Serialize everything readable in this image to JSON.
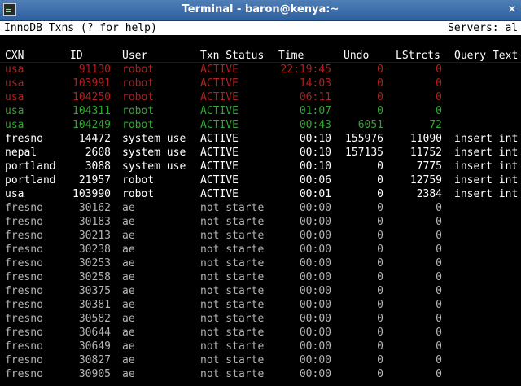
{
  "window": {
    "title": "Terminal - baron@kenya:~",
    "close_glyph": "×"
  },
  "infobar": {
    "left": "InnoDB Txns (? for help)",
    "right": "Servers: al"
  },
  "table": {
    "columns": [
      "CXN",
      "ID",
      "User",
      "Txn Status",
      "Time",
      "Undo",
      "LStrcts",
      "Query Text"
    ],
    "rows": [
      {
        "cxn": "usa",
        "id": "91130",
        "user": "robot",
        "status": "ACTIVE",
        "time": "22:19:45",
        "undo": "0",
        "lstr": "0",
        "query": "",
        "color": "red"
      },
      {
        "cxn": "usa",
        "id": "103991",
        "user": "robot",
        "status": "ACTIVE",
        "time": "14:03",
        "undo": "0",
        "lstr": "0",
        "query": "",
        "color": "red"
      },
      {
        "cxn": "usa",
        "id": "104250",
        "user": "robot",
        "status": "ACTIVE",
        "time": "06:11",
        "undo": "0",
        "lstr": "0",
        "query": "",
        "color": "red"
      },
      {
        "cxn": "usa",
        "id": "104311",
        "user": "robot",
        "status": "ACTIVE",
        "time": "01:07",
        "undo": "0",
        "lstr": "0",
        "query": "",
        "color": "green"
      },
      {
        "cxn": "usa",
        "id": "104249",
        "user": "robot",
        "status": "ACTIVE",
        "time": "00:43",
        "undo": "6051",
        "lstr": "72",
        "query": "",
        "color": "green"
      },
      {
        "cxn": "fresno",
        "id": "14472",
        "user": "system use",
        "status": "ACTIVE",
        "time": "00:10",
        "undo": "155976",
        "lstr": "11090",
        "query": "insert int",
        "color": "white"
      },
      {
        "cxn": "nepal",
        "id": "2608",
        "user": "system use",
        "status": "ACTIVE",
        "time": "00:10",
        "undo": "157135",
        "lstr": "11752",
        "query": "insert int",
        "color": "white"
      },
      {
        "cxn": "portland",
        "id": "3088",
        "user": "system use",
        "status": "ACTIVE",
        "time": "00:10",
        "undo": "0",
        "lstr": "7775",
        "query": "insert int",
        "color": "white"
      },
      {
        "cxn": "portland",
        "id": "21957",
        "user": "robot",
        "status": "ACTIVE",
        "time": "00:06",
        "undo": "0",
        "lstr": "12759",
        "query": "insert int",
        "color": "white"
      },
      {
        "cxn": "usa",
        "id": "103990",
        "user": "robot",
        "status": "ACTIVE",
        "time": "00:01",
        "undo": "0",
        "lstr": "2384",
        "query": "insert int",
        "color": "white"
      },
      {
        "cxn": "fresno",
        "id": "30162",
        "user": "ae",
        "status": "not starte",
        "time": "00:00",
        "undo": "0",
        "lstr": "0",
        "query": "",
        "color": "gray"
      },
      {
        "cxn": "fresno",
        "id": "30183",
        "user": "ae",
        "status": "not starte",
        "time": "00:00",
        "undo": "0",
        "lstr": "0",
        "query": "",
        "color": "gray"
      },
      {
        "cxn": "fresno",
        "id": "30213",
        "user": "ae",
        "status": "not starte",
        "time": "00:00",
        "undo": "0",
        "lstr": "0",
        "query": "",
        "color": "gray"
      },
      {
        "cxn": "fresno",
        "id": "30238",
        "user": "ae",
        "status": "not starte",
        "time": "00:00",
        "undo": "0",
        "lstr": "0",
        "query": "",
        "color": "gray"
      },
      {
        "cxn": "fresno",
        "id": "30253",
        "user": "ae",
        "status": "not starte",
        "time": "00:00",
        "undo": "0",
        "lstr": "0",
        "query": "",
        "color": "gray"
      },
      {
        "cxn": "fresno",
        "id": "30258",
        "user": "ae",
        "status": "not starte",
        "time": "00:00",
        "undo": "0",
        "lstr": "0",
        "query": "",
        "color": "gray"
      },
      {
        "cxn": "fresno",
        "id": "30375",
        "user": "ae",
        "status": "not starte",
        "time": "00:00",
        "undo": "0",
        "lstr": "0",
        "query": "",
        "color": "gray"
      },
      {
        "cxn": "fresno",
        "id": "30381",
        "user": "ae",
        "status": "not starte",
        "time": "00:00",
        "undo": "0",
        "lstr": "0",
        "query": "",
        "color": "gray"
      },
      {
        "cxn": "fresno",
        "id": "30582",
        "user": "ae",
        "status": "not starte",
        "time": "00:00",
        "undo": "0",
        "lstr": "0",
        "query": "",
        "color": "gray"
      },
      {
        "cxn": "fresno",
        "id": "30644",
        "user": "ae",
        "status": "not starte",
        "time": "00:00",
        "undo": "0",
        "lstr": "0",
        "query": "",
        "color": "gray"
      },
      {
        "cxn": "fresno",
        "id": "30649",
        "user": "ae",
        "status": "not starte",
        "time": "00:00",
        "undo": "0",
        "lstr": "0",
        "query": "",
        "color": "gray"
      },
      {
        "cxn": "fresno",
        "id": "30827",
        "user": "ae",
        "status": "not starte",
        "time": "00:00",
        "undo": "0",
        "lstr": "0",
        "query": "",
        "color": "gray"
      },
      {
        "cxn": "fresno",
        "id": "30905",
        "user": "ae",
        "status": "not starte",
        "time": "00:00",
        "undo": "0",
        "lstr": "0",
        "query": "",
        "color": "gray"
      }
    ]
  },
  "colors": {
    "red": "#b31f1f",
    "green": "#2ea82e",
    "white": "#ffffff",
    "gray": "#b4b4b4",
    "titlebar": "#3f6faa"
  }
}
